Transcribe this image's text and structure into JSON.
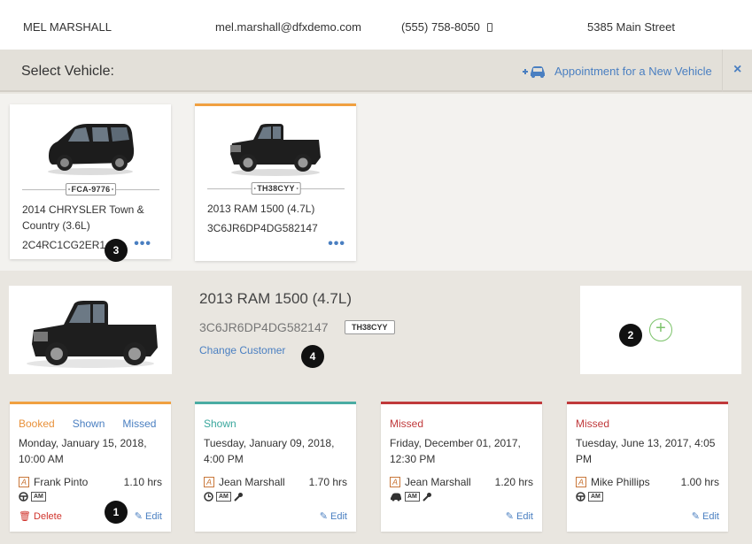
{
  "customer": {
    "name": "MEL MARSHALL",
    "email": "mel.marshall@dfxdemo.com",
    "phone": "(555) 758-8050",
    "address": "5385 Main Street"
  },
  "select_bar": {
    "title": "Select Vehicle:",
    "new_vehicle_label": "Appointment for a New Vehicle",
    "close": "×"
  },
  "vehicles": [
    {
      "plate": "FCA-9776",
      "name": "2014 CHRYSLER Town & Country (3.6L)",
      "vin": "2C4RC1CG2ER144",
      "more": "•••"
    },
    {
      "plate": "TH38CYY",
      "name": "2013 RAM 1500 (4.7L)",
      "vin": "3C6JR6DP4DG582147",
      "more": "•••"
    }
  ],
  "selected_vehicle": {
    "title": "2013 RAM 1500 (4.7L)",
    "vin": "3C6JR6DP4DG582147",
    "plate": "TH38CYY",
    "change_customer": "Change Customer",
    "add": "+"
  },
  "badges": [
    "1",
    "2",
    "3",
    "4"
  ],
  "appointments": [
    {
      "statuses": [
        {
          "label": "Booked",
          "color": "#e8913a"
        },
        {
          "label": "Shown",
          "color": "#4a7fc1"
        },
        {
          "label": "Missed",
          "color": "#4a7fc1"
        }
      ],
      "accent": "#f0a040",
      "date": "Monday, January 15, 2018, 10:00 AM",
      "advisor_initial": "A",
      "advisor": "Frank Pinto",
      "hours": "1.10 hrs",
      "am": "AM",
      "delete": "Delete",
      "edit": "Edit"
    },
    {
      "statuses": [
        {
          "label": "Shown",
          "color": "#3aa79d"
        }
      ],
      "accent": "#4aaca3",
      "date": "Tuesday, January 09, 2018, 4:00 PM",
      "advisor_initial": "A",
      "advisor": "Jean Marshall",
      "hours": "1.70 hrs",
      "am": "AM",
      "edit": "Edit"
    },
    {
      "statuses": [
        {
          "label": "Missed",
          "color": "#c0393b"
        }
      ],
      "accent": "#c0393b",
      "date": "Friday, December 01, 2017, 12:30 PM",
      "advisor_initial": "A",
      "advisor": "Jean Marshall",
      "hours": "1.20 hrs",
      "am": "AM",
      "edit": "Edit"
    },
    {
      "statuses": [
        {
          "label": "Missed",
          "color": "#c0393b"
        }
      ],
      "accent": "#c0393b",
      "date": "Tuesday, June 13, 2017, 4:05 PM",
      "advisor_initial": "A",
      "advisor": "Mike Phillips",
      "hours": "1.00 hrs",
      "am": "AM",
      "edit": "Edit"
    }
  ]
}
